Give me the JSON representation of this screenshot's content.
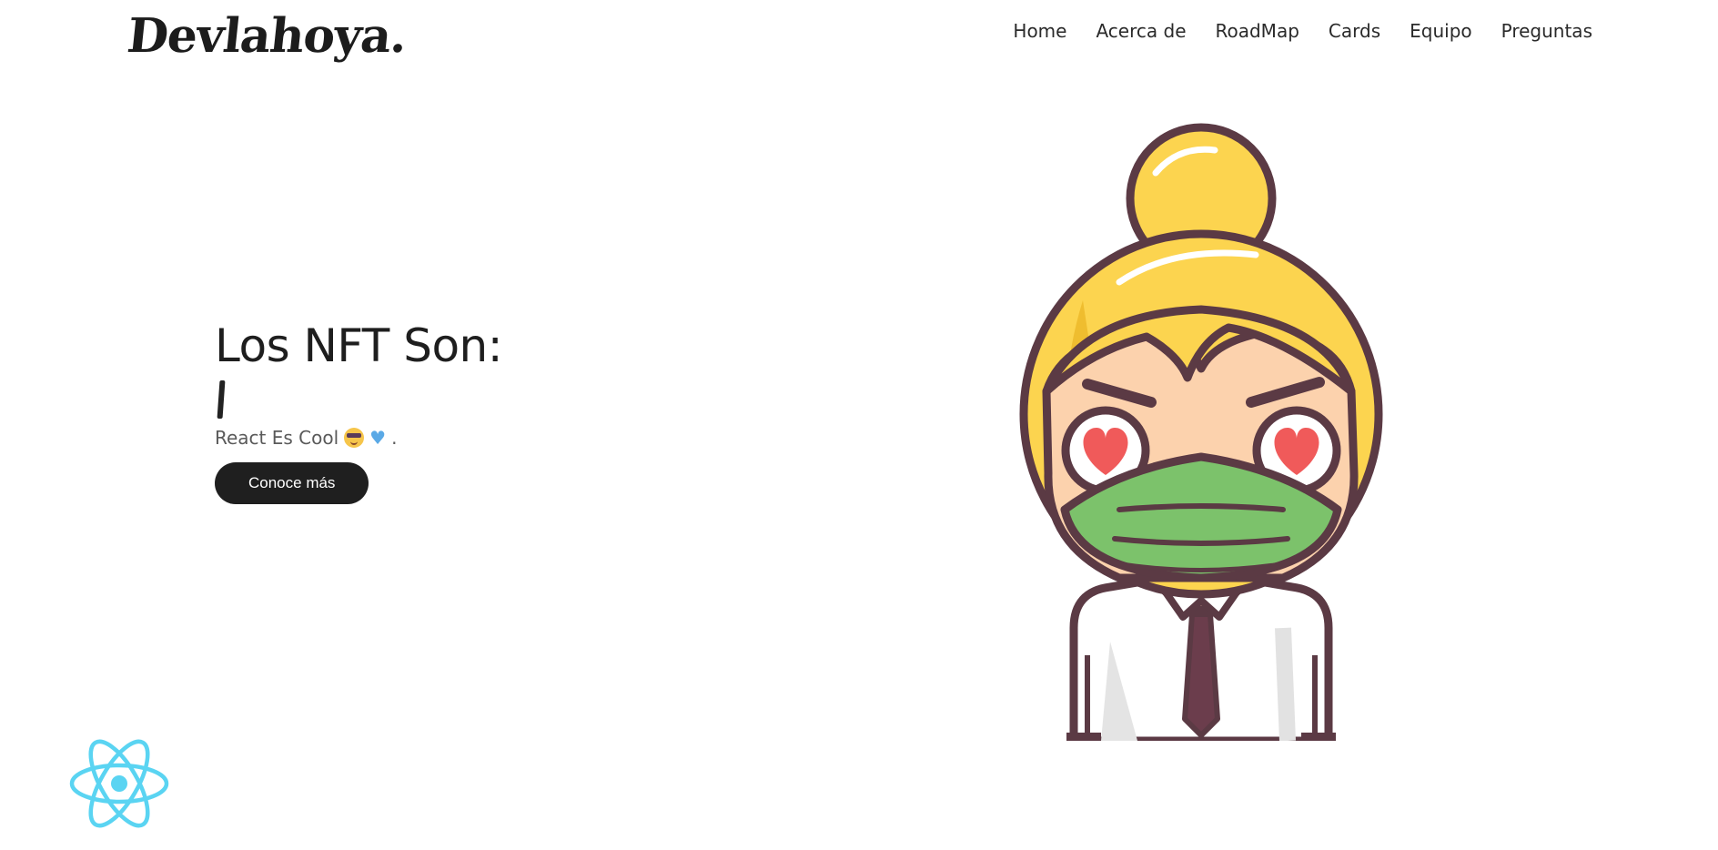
{
  "header": {
    "logo": "Devlahoya.",
    "nav": [
      {
        "label": "Home"
      },
      {
        "label": "Acerca de"
      },
      {
        "label": "RoadMap"
      },
      {
        "label": "Cards"
      },
      {
        "label": "Equipo"
      },
      {
        "label": "Preguntas"
      }
    ]
  },
  "hero": {
    "title": "Los NFT Son:",
    "subtitle": "React Es Cool",
    "subtitle_suffix": ".",
    "cta_label": "Conoce más"
  },
  "icons": {
    "react_logo": "react-logo-icon",
    "cool_emoji": "sunglasses-emoji-icon",
    "heart_emoji": "blue-heart-icon",
    "avatar": "masked-girl-illustration"
  },
  "colors": {
    "button_bg": "#1f1f1f",
    "react_blue": "#5ad4f2",
    "hair": "#fcd44f",
    "mask": "#7cc26b",
    "outline": "#5b3a44"
  }
}
